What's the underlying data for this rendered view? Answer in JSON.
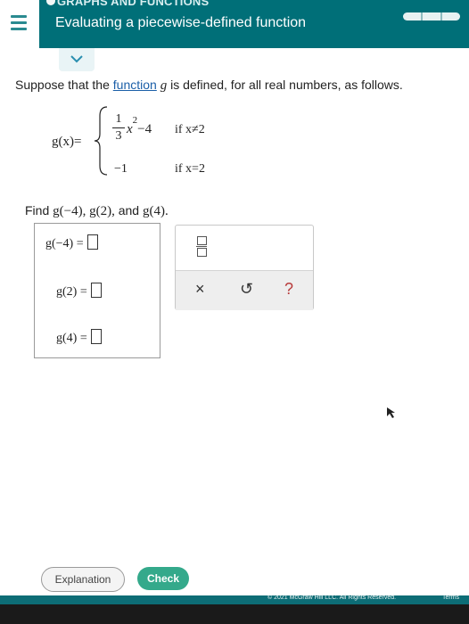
{
  "header": {
    "topic": "GRAPHS AND FUNCTIONS",
    "title": "Evaluating a piecewise-defined function"
  },
  "question": {
    "prefix": "Suppose that the",
    "link": "function",
    "var": "g",
    "suffix": "is defined, for all real numbers, as follows."
  },
  "piecewise": {
    "lhs": "g(x)=",
    "frac_num": "1",
    "frac_den": "3",
    "case1_expr_x": "x",
    "case1_exp": "2",
    "case1_rest": "−4",
    "case1_cond": "if x≠2",
    "case2_expr": "−1",
    "case2_cond": "if x=2"
  },
  "find": {
    "prefix": "Find",
    "items": "g(−4), g(2),",
    "and": "and",
    "last": "g(4)."
  },
  "answers": [
    {
      "label": "g(−4) ="
    },
    {
      "label": "g(2) ="
    },
    {
      "label": "g(4) ="
    }
  ],
  "toolbar": {
    "fraction_icon": "fraction-icon",
    "clear": "×",
    "undo": "↺",
    "help": "?"
  },
  "buttons": {
    "explanation": "Explanation",
    "check": "Check"
  },
  "footer": {
    "copyright": "© 2021 McGraw Hill LLC. All Rights Reserved.",
    "terms": "Terms"
  },
  "colors": {
    "header_bg": "#006f78",
    "check_btn": "#34a98b",
    "link": "#1b5fa8"
  }
}
